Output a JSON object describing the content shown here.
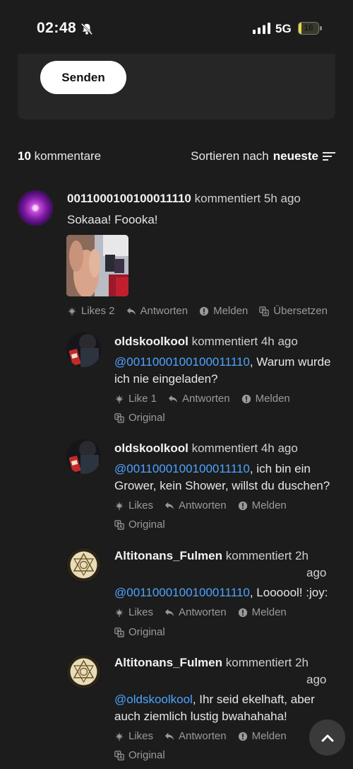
{
  "status_bar": {
    "time": "02:48",
    "network": "5G",
    "battery": "16",
    "battery_level": 0.16
  },
  "composer": {
    "send_label": "Senden"
  },
  "header": {
    "count": "10",
    "count_label": "kommentare",
    "sort_prefix": "Sortieren nach",
    "sort_value": "neueste"
  },
  "comments": [
    {
      "user": "0011000100100011110",
      "verb": "kommentiert",
      "time": "5h ago",
      "text": "Sokaaa! Foooka!",
      "likes": "Likes 2",
      "reply": "Antworten",
      "report": "Melden",
      "translate": "Übersetzen"
    },
    {
      "user": "oldskoolkool",
      "verb": "kommentiert",
      "time": "4h ago",
      "mention": "@0011000100100011110",
      "text": ", Warum wurde ich nie eingeladen?",
      "likes": "Like 1",
      "reply": "Antworten",
      "report": "Melden",
      "original": "Original"
    },
    {
      "user": "oldskoolkool",
      "verb": "kommentiert",
      "time": "4h ago",
      "mention": "@0011000100100011110",
      "text": ", ich bin ein Grower, kein Shower, willst du duschen?",
      "likes": "Likes",
      "reply": "Antworten",
      "report": "Melden",
      "original": "Original"
    },
    {
      "user": "Altitonans_Fulmen",
      "verb": "kommentiert",
      "time_a": "2h",
      "time_b": "ago",
      "mention": "@0011000100100011110",
      "text": ", Loooool! :joy:",
      "likes": "Likes",
      "reply": "Antworten",
      "report": "Melden",
      "original": "Original"
    },
    {
      "user": "Altitonans_Fulmen",
      "verb": "kommentiert",
      "time_a": "2h",
      "time_b": "ago",
      "mention": "@oldskoolkool",
      "text": ", Ihr seid ekelhaft, aber auch ziemlich lustig bwahahaha!",
      "likes": "Likes",
      "reply": "Antworten",
      "report": "Melden",
      "original": "Original"
    }
  ],
  "icons": {
    "like": "leaf-icon",
    "reply": "reply-arrow-icon",
    "report": "alert-circle-icon",
    "translate": "translate-icon",
    "sort": "sort-lines-icon",
    "scroll": "chevron-up-icon"
  }
}
